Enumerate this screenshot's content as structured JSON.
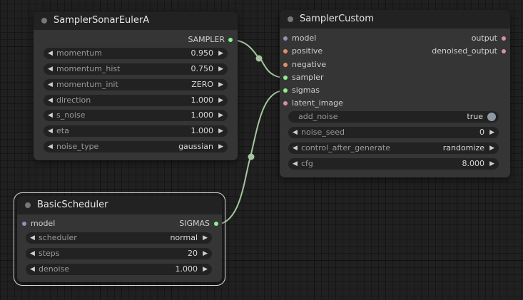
{
  "nodes": {
    "sonar": {
      "title": "SamplerSonarEulerA",
      "outputs": [
        "SAMPLER"
      ],
      "widgets": [
        {
          "name": "momentum",
          "value": "0.950"
        },
        {
          "name": "momentum_hist",
          "value": "0.750"
        },
        {
          "name": "momentum_init",
          "value": "ZERO"
        },
        {
          "name": "direction",
          "value": "1.000"
        },
        {
          "name": "s_noise",
          "value": "1.000"
        },
        {
          "name": "eta",
          "value": "1.000"
        },
        {
          "name": "noise_type",
          "value": "gaussian"
        }
      ]
    },
    "custom": {
      "title": "SamplerCustom",
      "inputs": [
        "model",
        "positive",
        "negative",
        "sampler",
        "sigmas",
        "latent_image"
      ],
      "outputs": [
        "output",
        "denoised_output"
      ],
      "widgets": [
        {
          "name": "add_noise",
          "value": "true"
        },
        {
          "name": "noise_seed",
          "value": "0"
        },
        {
          "name": "control_after_generate",
          "value": "randomize"
        },
        {
          "name": "cfg",
          "value": "8.000"
        }
      ]
    },
    "scheduler": {
      "title": "BasicScheduler",
      "inputs": [
        "model"
      ],
      "outputs": [
        "SIGMAS"
      ],
      "widgets": [
        {
          "name": "scheduler",
          "value": "normal"
        },
        {
          "name": "steps",
          "value": "20"
        },
        {
          "name": "denoise",
          "value": "1.000"
        }
      ]
    }
  },
  "colors": {
    "model": "#a08bb9",
    "positive": "#e0916a",
    "negative": "#e0916a",
    "sampler": "#8ef08e",
    "sigmas": "#8ef08e",
    "latent_image": "#d58fb3",
    "output": "#d58fb3",
    "link": "#a5c69f"
  }
}
